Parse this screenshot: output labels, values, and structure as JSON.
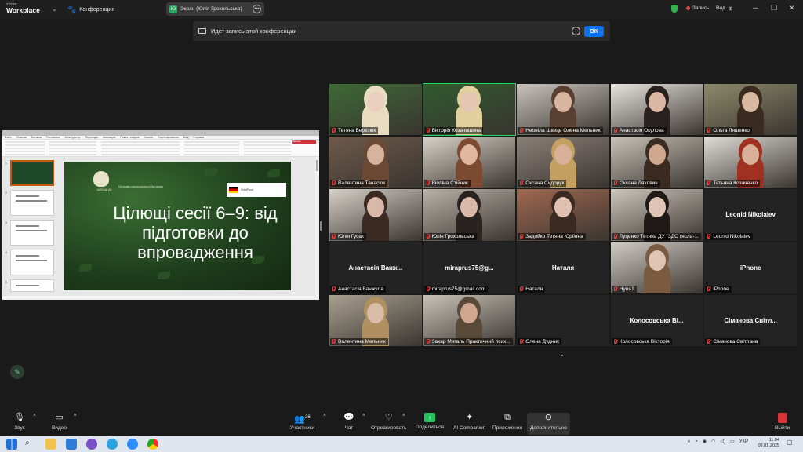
{
  "titlebar": {
    "app_brand_top": "zoom",
    "app_brand_bottom": "Workplace",
    "meeting_label": "Конференция",
    "screen_share_label": "Экран (Юлія Грохольська)",
    "record_label": "Запись",
    "view_label": "Вид"
  },
  "notice": {
    "text": "Идет запись этой конференции",
    "ok": "OK"
  },
  "presentation": {
    "menu": [
      "Файл",
      "Главная",
      "Вставка",
      "Рисование",
      "Конструктор",
      "Переходы",
      "Анимация",
      "Показ слайдов",
      "Запись",
      "Рецензирование",
      "Вид",
      "Справка"
    ],
    "record_btn": "Записать",
    "slide_title": "Цілющі сесії 6–9: від підготовки до впровадження",
    "slide_logo_text": "ЦІЛЮЩІ ДІЇ",
    "slide_sub": "Програма психосоціальної підтримки",
    "slide_badge": "ChildFund"
  },
  "participants": [
    {
      "name": "Тетяна Березюк",
      "video": true,
      "color": "#3d6a35",
      "skin": "#e8cfc0",
      "hair": "#e9dcc0"
    },
    {
      "name": "Вікторія Козачишина",
      "video": true,
      "active": true,
      "color": "#2f5a2d",
      "skin": "#e3c6b4",
      "hair": "#e2cf9e"
    },
    {
      "name": "Неоніла Швець Олена Мельник",
      "video": true,
      "color": "#c9c3bd",
      "skin": "#d8b5a0",
      "hair": "#5a4030"
    },
    {
      "name": "Анастасія Окулова",
      "video": true,
      "color": "#e8e4df",
      "skin": "#d9b7a4",
      "hair": "#2a2220"
    },
    {
      "name": "Ольга Ляшенко",
      "video": true,
      "color": "#8c8a6a",
      "skin": "#d8b8a0",
      "hair": "#3b2a20"
    },
    {
      "name": "Валентина Танасюк",
      "video": true,
      "color": "#6e5a4a",
      "skin": "#d6b39d",
      "hair": "#6a4a35"
    },
    {
      "name": "Віоліна Стійник",
      "video": true,
      "color": "#d9d2c8",
      "skin": "#e0b8a0",
      "hair": "#7b4a30"
    },
    {
      "name": "Оксана Сидорук",
      "video": true,
      "color": "#8a8078",
      "skin": "#d8b09a",
      "hair": "#c4a060"
    },
    {
      "name": "Оксана Ляхович",
      "video": true,
      "color": "#c8c2b8",
      "skin": "#d0a890",
      "hair": "#3a2a20"
    },
    {
      "name": "Тетьяна Козаченко",
      "video": true,
      "color": "#e0dcd6",
      "skin": "#d8b09a",
      "hair": "#a03020"
    },
    {
      "name": "Юлія Гусак",
      "video": true,
      "color": "#d6d0c8",
      "skin": "#d8b8a8",
      "hair": "#3a2a22"
    },
    {
      "name": "Юлія Грохольська",
      "video": true,
      "color": "#b8b2a8",
      "skin": "#d8b8a8",
      "hair": "#2a2220"
    },
    {
      "name": "Задойко Тетяна Юріївна",
      "video": true,
      "color": "#a06850",
      "skin": "#e0c0b0",
      "hair": "#3a2a22"
    },
    {
      "name": "Луценко Тетяна ДУ \"ЗДО (ясла-...",
      "video": true,
      "color": "#cdc6bc",
      "skin": "#e0c4b6",
      "hair": "#1f1a18"
    },
    {
      "name": "Leonid Nikolaiev",
      "video": false,
      "big": "Leonid Nikolaiev"
    },
    {
      "name": "Анастасія Ванжула",
      "video": false,
      "big": "Анастасія Ванж..."
    },
    {
      "name": "miraprus75@gmail.com",
      "video": false,
      "big": "miraprus75@g..."
    },
    {
      "name": "Наталя",
      "video": false,
      "big": "Наталя"
    },
    {
      "name": "Нуш-1",
      "video": true,
      "color": "#d0ccc4",
      "skin": "#e0c4b4",
      "hair": "#7a5a40"
    },
    {
      "name": "iPhone",
      "video": false,
      "big": "iPhone"
    },
    {
      "name": "Валентина Мельник",
      "video": true,
      "color": "#a8a090",
      "skin": "#d8bca8",
      "hair": "#b09060"
    },
    {
      "name": "Захар Мигаль Практичний псих...",
      "video": true,
      "color": "#c8c2b8",
      "skin": "#d0a890",
      "hair": "#5a4a3a"
    },
    {
      "name": "Олена Дудник",
      "video": false,
      "big": ""
    },
    {
      "name": "Колосовська Вікторія",
      "video": false,
      "big": "Колосовська Ві..."
    },
    {
      "name": "Сімачова Світлана",
      "video": false,
      "big": "Сімачова Світл..."
    }
  ],
  "toolbar": {
    "audio": "Звук",
    "video": "Видео",
    "participants": "Участники",
    "participants_count": "26",
    "chat": "Чат",
    "react": "Отреагировать",
    "share": "Поделиться",
    "ai": "AI Companion",
    "apps": "Приложения",
    "more": "Дополнительно",
    "leave": "Выйти"
  },
  "taskbar": {
    "lang": "УКР",
    "time": "11:04",
    "date": "09.01.2025"
  }
}
